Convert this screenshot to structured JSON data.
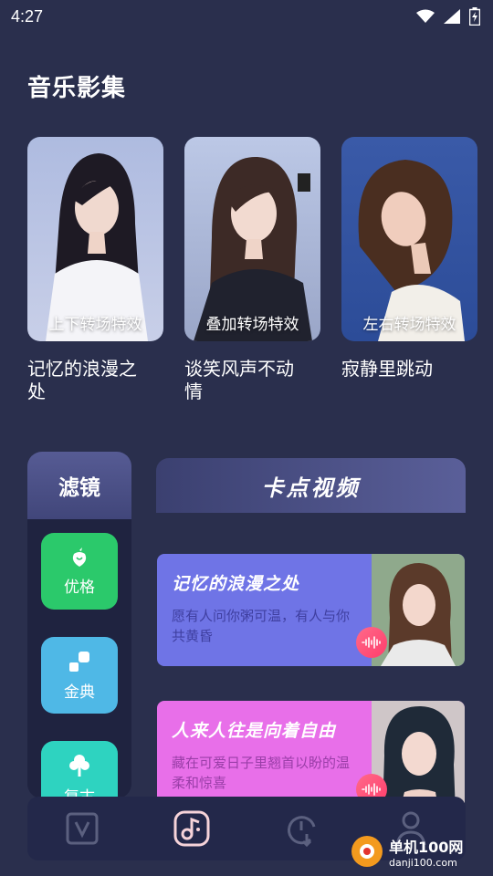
{
  "status_bar": {
    "time": "4:27"
  },
  "music_album": {
    "title": "音乐影集",
    "albums": [
      {
        "effect": "上下转场特效",
        "name": "记忆的浪漫之处"
      },
      {
        "effect": "叠加转场特效",
        "name": "谈笑风声不动情"
      },
      {
        "effect": "左右转场特效",
        "name": "寂静里跳动"
      }
    ]
  },
  "filter": {
    "title": "滤镜",
    "items": [
      {
        "label": "优格",
        "icon": "fruit-icon",
        "color": "#2bc96b"
      },
      {
        "label": "金典",
        "icon": "shapes-icon",
        "color": "#4fb8e6"
      },
      {
        "label": "复古",
        "icon": "tree-icon",
        "color": "#2ed3c0"
      }
    ]
  },
  "beat_video": {
    "title": "卡点视频",
    "cards": [
      {
        "title": "记忆的浪漫之处",
        "subtitle": "愿有人问你粥可温，有人与你共黄昏",
        "bg": "#6f74e6",
        "subtitle_color": "#3f3fa0"
      },
      {
        "title": "人来人往是向着自由",
        "subtitle": "藏在可爱日子里翘首以盼的温柔和惊喜",
        "bg": "#e86fe9",
        "subtitle_color": "#9a3ea8"
      }
    ]
  },
  "bottom_nav": {
    "items": [
      {
        "icon": "video-icon"
      },
      {
        "icon": "music-icon"
      },
      {
        "icon": "timer-icon"
      },
      {
        "icon": "user-icon"
      }
    ]
  },
  "watermark": {
    "line1": "单机100网",
    "line2": "danji100.com"
  }
}
